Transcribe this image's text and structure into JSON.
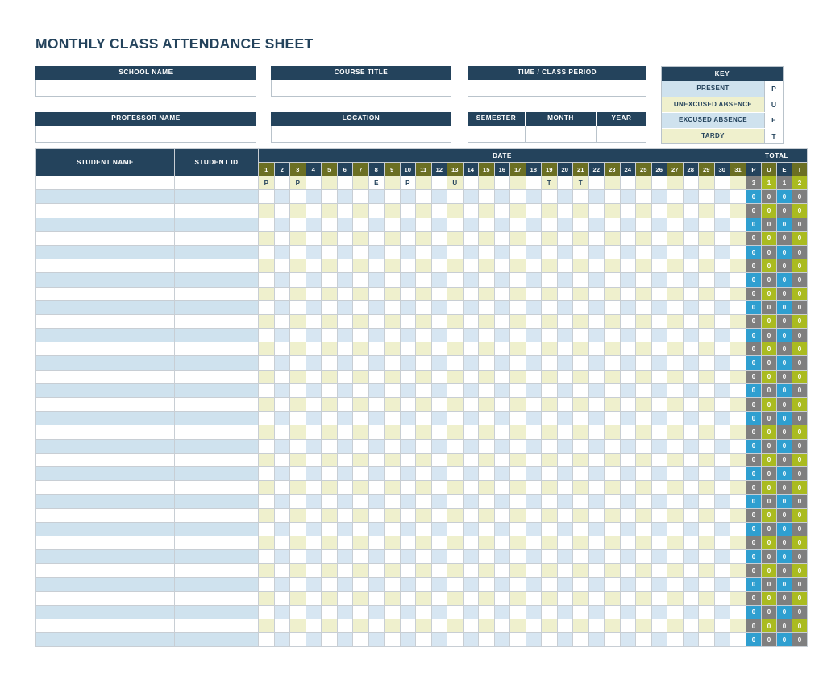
{
  "title": "MONTHLY CLASS ATTENDANCE SHEET",
  "colors": {
    "navy": "#24435c",
    "olive_header": "#6b6f23",
    "pale_blue": "#cfe2ee",
    "pale_olive": "#eff0cd",
    "total_gray": "#7f7f7f",
    "total_olive": "#aabb20",
    "total_blue": "#2f9fd0"
  },
  "header_fields": [
    {
      "label": "SCHOOL NAME",
      "value": "",
      "placeholder": ""
    },
    {
      "label": "COURSE TITLE",
      "value": "",
      "placeholder": ""
    },
    {
      "label": "TIME / CLASS PERIOD",
      "value": "",
      "placeholder": ""
    },
    {
      "label": "PROFESSOR NAME",
      "value": "",
      "placeholder": ""
    },
    {
      "label": "LOCATION",
      "value": "",
      "placeholder": ""
    }
  ],
  "term_fields": [
    {
      "label": "SEMESTER",
      "value": "",
      "placeholder": ""
    },
    {
      "label": "MONTH",
      "value": "",
      "placeholder": ""
    },
    {
      "label": "YEAR",
      "value": "",
      "placeholder": ""
    }
  ],
  "key": {
    "title": "KEY",
    "rows": [
      {
        "name": "PRESENT",
        "code": "P",
        "swatch": "key-blue"
      },
      {
        "name": "UNEXCUSED ABSENCE",
        "code": "U",
        "swatch": "key-olive"
      },
      {
        "name": "EXCUSED ABSENCE",
        "code": "E",
        "swatch": "key-blue"
      },
      {
        "name": "TARDY",
        "code": "T",
        "swatch": "key-olive"
      }
    ]
  },
  "table": {
    "col_student_name": "STUDENT NAME",
    "col_student_id": "STUDENT ID",
    "group_date": "DATE",
    "group_total": "TOTAL",
    "days": [
      1,
      2,
      3,
      4,
      5,
      6,
      7,
      8,
      9,
      10,
      11,
      12,
      13,
      14,
      15,
      16,
      17,
      18,
      19,
      20,
      21,
      22,
      23,
      24,
      25,
      26,
      27,
      28,
      29,
      30,
      31
    ],
    "total_cols": [
      "P",
      "U",
      "E",
      "T"
    ],
    "row_count": 34,
    "rows": [
      {
        "student_name": "",
        "student_id": "",
        "marks": {
          "1": "P",
          "3": "P",
          "8": "E",
          "10": "P",
          "13": "U",
          "19": "T",
          "21": "T"
        },
        "totals": [
          "3",
          "1",
          "1",
          "2"
        ]
      }
    ],
    "empty_total_value": "0"
  }
}
